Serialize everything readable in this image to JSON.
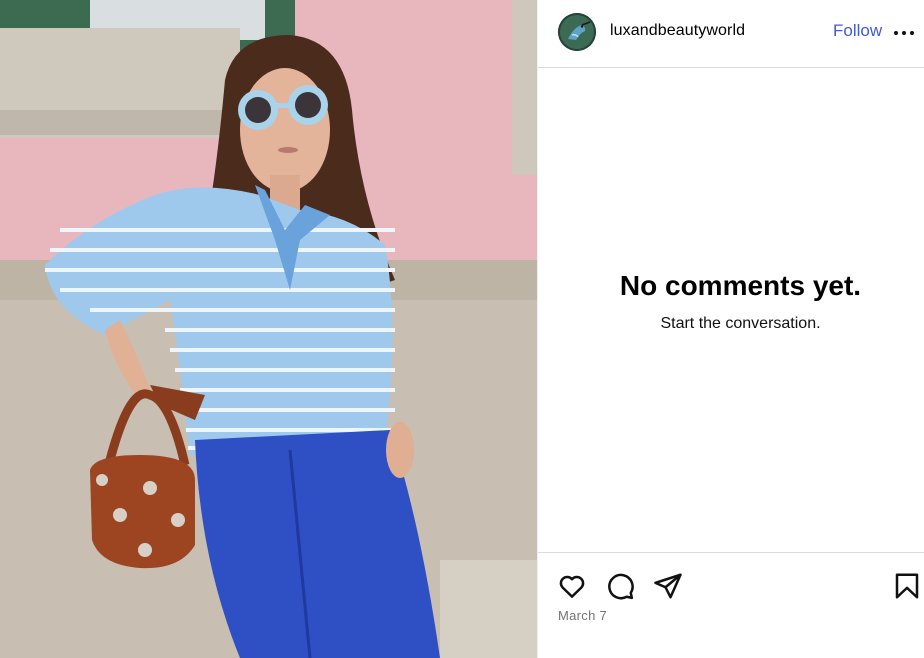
{
  "post": {
    "username": "luxandbeautyworld",
    "follow_label": "Follow",
    "date": "March 7"
  },
  "comments": {
    "empty_title": "No comments yet.",
    "empty_subtitle": "Start the conversation."
  },
  "icons": {
    "avatar": "hummingbird-avatar",
    "more": "more-options-icon",
    "like": "heart-icon",
    "comment": "comment-bubble-icon",
    "share": "paper-plane-icon",
    "save": "bookmark-icon"
  },
  "colors": {
    "follow": "#3d5bd6",
    "divider": "#dbdbdb",
    "muted_text": "#737373"
  }
}
